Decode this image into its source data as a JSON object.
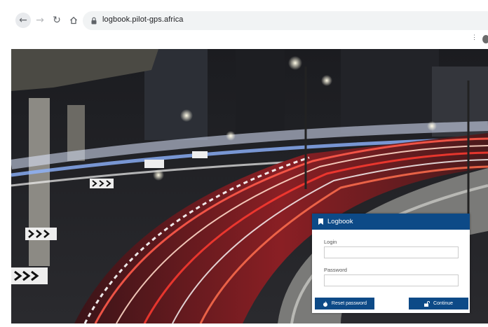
{
  "browser": {
    "url": "logbook.pilot-gps.africa",
    "icons": [
      "back-arrow-icon",
      "forward-arrow-icon",
      "reload-icon",
      "home-icon",
      "lock-icon",
      "more-menu-icon"
    ]
  },
  "login": {
    "header_title": "Logbook",
    "login_label": "Login",
    "login_value": "",
    "password_label": "Password",
    "password_value": "",
    "reset_button": "Reset password",
    "continue_button": "Continue"
  },
  "colors": {
    "brand": "#0d4a87",
    "card_bg": "#ffffff"
  }
}
